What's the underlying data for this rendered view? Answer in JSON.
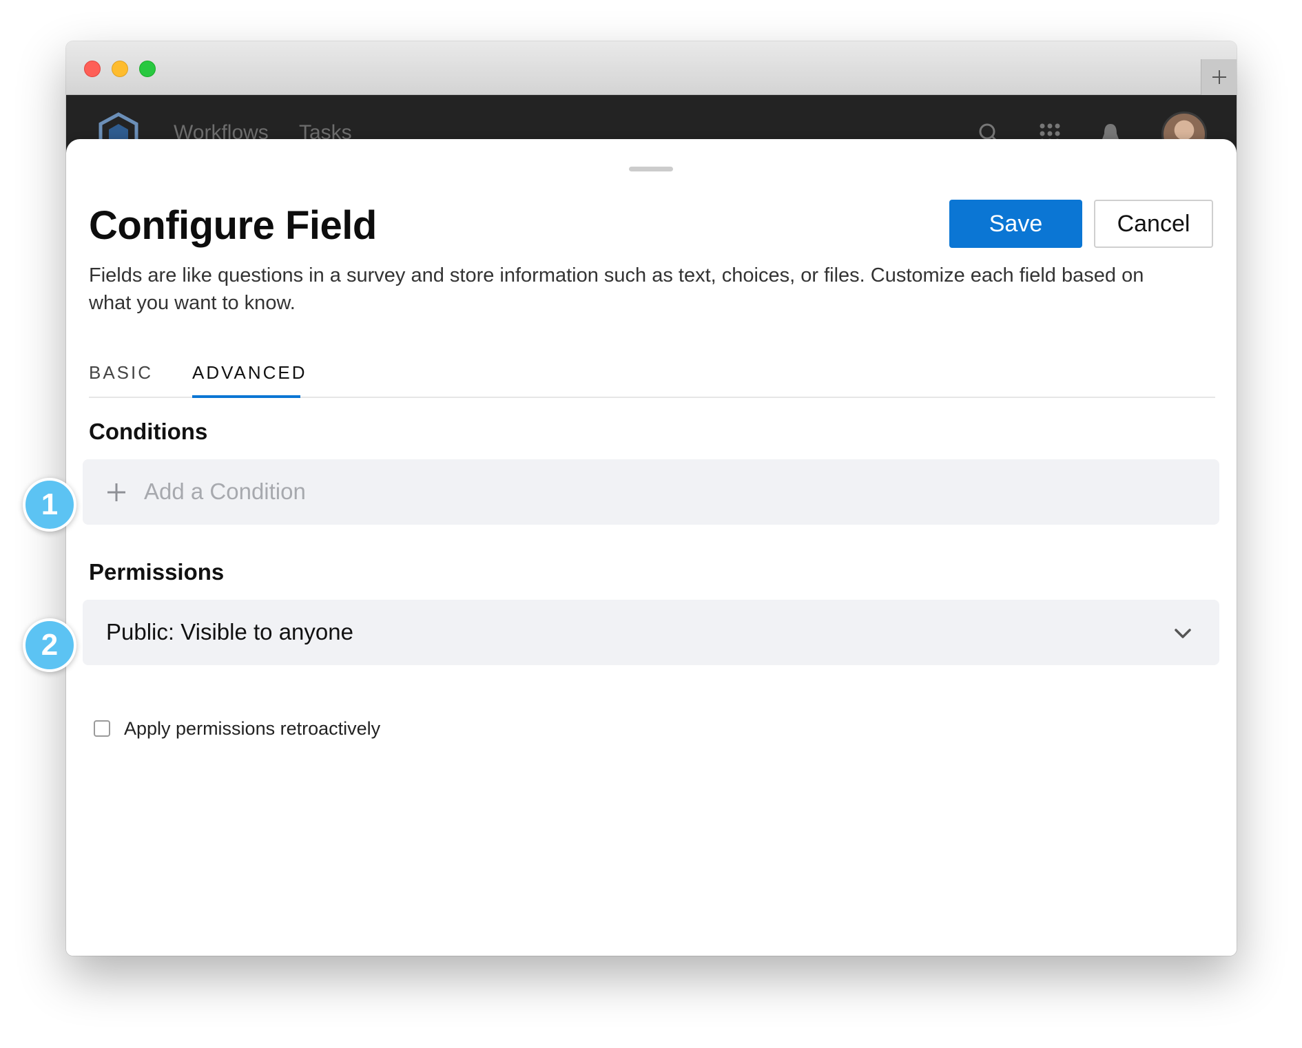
{
  "nav": {
    "links": [
      "Workflows",
      "Tasks"
    ],
    "icons": [
      "search-icon",
      "apps-grid-icon",
      "bell-icon"
    ],
    "background": "#232323"
  },
  "sheet": {
    "title": "Configure Field",
    "description": "Fields are like questions in a survey and store information such as text, choices, or files. Customize each field based on what you want to know.",
    "save_label": "Save",
    "cancel_label": "Cancel",
    "accent": "#0b76d4"
  },
  "tabs": [
    {
      "label": "BASIC",
      "active": false
    },
    {
      "label": "ADVANCED",
      "active": true
    }
  ],
  "conditions": {
    "heading": "Conditions",
    "add_label": "Add a Condition"
  },
  "permissions": {
    "heading": "Permissions",
    "selected": "Public: Visible to anyone",
    "retro_label": "Apply permissions retroactively",
    "retro_checked": false
  },
  "callouts": [
    "1",
    "2"
  ]
}
